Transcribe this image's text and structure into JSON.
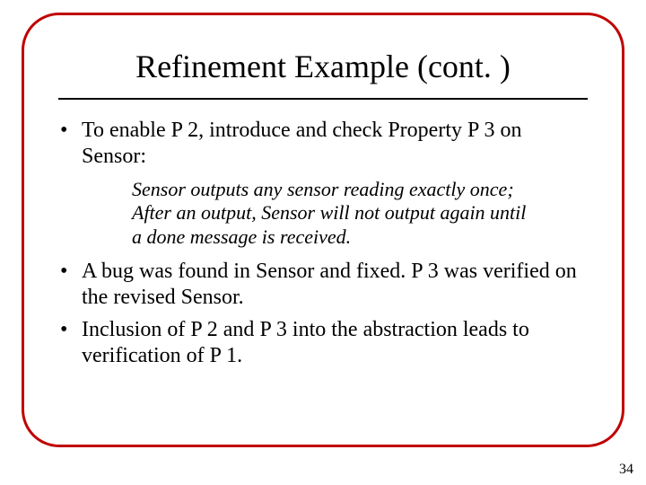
{
  "slide": {
    "title": "Refinement Example (cont. )",
    "bullets": {
      "b1": {
        "t1": "To enable ",
        "p2": "P 2",
        "t2": ", introduce and check ",
        "prop_p3": "Property P 3",
        "t3": " on Sensor:"
      },
      "quote": {
        "line1": "Sensor outputs any sensor reading exactly once;",
        "line2": "After an output, Sensor will not output again until",
        "line3": "a done message is received."
      },
      "b2": {
        "t1": "A bug was found in Sensor and fixed. ",
        "p3": "P 3",
        "t2": " was verified on the revised Sensor."
      },
      "b3": {
        "t1": "Inclusion of ",
        "p2": "P 2",
        "t2": " and ",
        "p3": "P 3",
        "t3": " into the abstraction leads to verification of ",
        "p1": "P 1",
        "t4": "."
      }
    },
    "page_number": "34"
  }
}
